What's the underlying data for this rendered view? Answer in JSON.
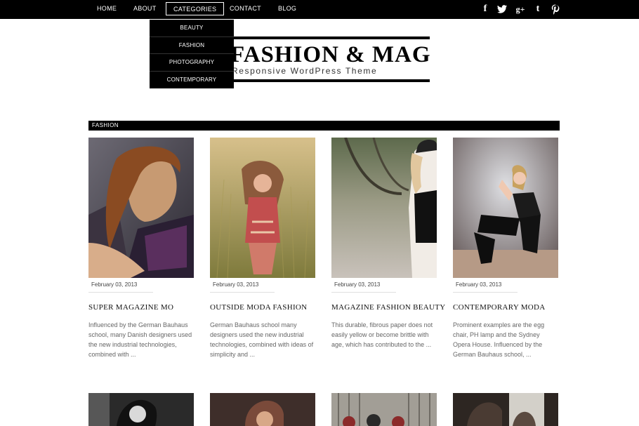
{
  "nav": {
    "items": [
      "Home",
      "About",
      "Categories",
      "Contact",
      "Blog"
    ],
    "active": "Categories"
  },
  "social": [
    {
      "icon": "facebook-icon",
      "glyph": "f"
    },
    {
      "icon": "twitter-icon",
      "glyph": "t"
    },
    {
      "icon": "google-plus-icon",
      "glyph": "g+"
    },
    {
      "icon": "tumblr-icon",
      "glyph": "t"
    },
    {
      "icon": "pinterest-icon",
      "glyph": "p"
    }
  ],
  "dropdown": {
    "items": [
      "Beauty",
      "Fashion",
      "Photography",
      "Contemporary"
    ]
  },
  "logo": {
    "title": "FASHION & MAG",
    "subtitle": "Responsive WordPress Theme"
  },
  "section": {
    "title": "Fashion"
  },
  "posts": [
    {
      "date": "February 03, 2013",
      "title": "Super Magazine Mo",
      "excerpt": "Influenced by the German Bauhaus school, many Danish designers used the new industrial technologies, combined with ..."
    },
    {
      "date": "February 03, 2013",
      "title": "Outside Moda Fashion",
      "excerpt": "German Bauhaus school many designers used the new industrial technologies, combined with ideas of simplicity and ..."
    },
    {
      "date": "February 03, 2013",
      "title": "Magazine Fashion Beauty",
      "excerpt": "This durable, fibrous paper does not easily yellow or become brittle with age, which has contributed to the ..."
    },
    {
      "date": "February 03, 2013",
      "title": "Contemporary Moda",
      "excerpt": "Prominent examples are the egg chair, PH lamp and the Sydney Opera House. Influenced by the German Bauhaus school, ..."
    }
  ],
  "colors": {
    "bar": "#000000",
    "text": "#111111",
    "excerpt": "#666666"
  }
}
